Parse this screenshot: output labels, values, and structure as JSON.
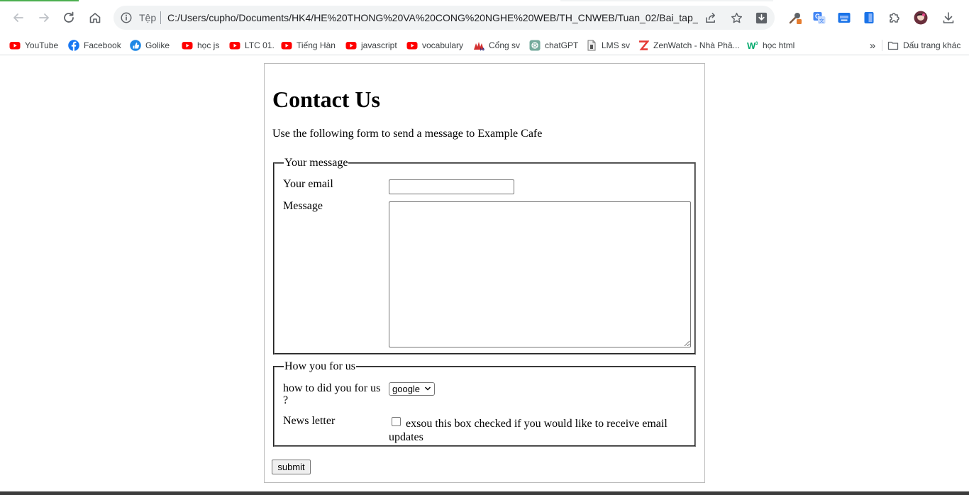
{
  "browser": {
    "omnibox": {
      "scheme_label": "Tệp",
      "url": "C:/Users/cupho/Documents/HK4/HE%20THONG%20VA%20CONG%20NGHE%20WEB/TH_CNWEB/Tuan_02/Bai_tap_15/..."
    },
    "accent_color": "#4caf50"
  },
  "bookmarks": {
    "items": [
      {
        "label": "YouTube",
        "icon": "youtube-icon"
      },
      {
        "label": "Facebook",
        "icon": "facebook-icon"
      },
      {
        "label": "Golike",
        "icon": "golike-icon"
      },
      {
        "label": "học js",
        "icon": "youtube-icon"
      },
      {
        "label": "LTC 01.",
        "icon": "youtube-icon"
      },
      {
        "label": "Tiếng Hàn",
        "icon": "youtube-icon"
      },
      {
        "label": "javascript",
        "icon": "youtube-icon"
      },
      {
        "label": "vocabulary",
        "icon": "youtube-icon"
      },
      {
        "label": "Cổng sv",
        "icon": "university-icon"
      },
      {
        "label": "chatGPT",
        "icon": "chatgpt-icon"
      },
      {
        "label": "LMS sv",
        "icon": "document-icon"
      },
      {
        "label": "ZenWatch - Nhà Phâ...",
        "icon": "zenwatch-icon"
      },
      {
        "label": "học html",
        "icon": "w3schools-icon"
      }
    ],
    "more_label": "»",
    "other_label": "Dấu trang khác"
  },
  "page": {
    "title": "Contact Us",
    "description": "Use the following form to send a message to Example Cafe",
    "message_fieldset": {
      "legend": "Your message",
      "email_label": "Your email",
      "email_value": "",
      "message_label": "Message",
      "message_value": ""
    },
    "source_fieldset": {
      "legend": "How you for us",
      "source_label": "how to did you for us ?",
      "source_selected": "google",
      "newsletter_label": "News letter",
      "newsletter_checked": false,
      "newsletter_text": "exsou this box checked if you would like to receive email updates"
    },
    "submit_label": "submit"
  }
}
